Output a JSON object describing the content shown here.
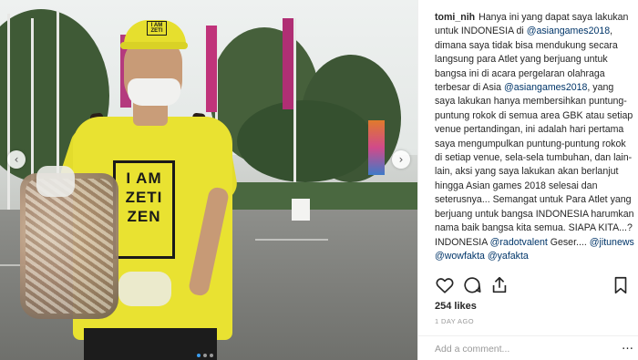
{
  "photo": {
    "cap_text": "I AM ZETI",
    "shirt_text": [
      "I AM",
      "ZETI",
      "ZEN"
    ],
    "nav_prev": "‹",
    "nav_next": "›"
  },
  "post": {
    "username": "tomi_nih",
    "caption_segments": [
      {
        "t": "Hanya ini yang dapat saya lakukan untuk INDONESIA di ",
        "m": false
      },
      {
        "t": "@asiangames2018",
        "m": true
      },
      {
        "t": ", dimana saya tidak bisa mendukung secara langsung para Atlet yang berjuang untuk bangsa ini di acara pergelaran olahraga terbesar di Asia ",
        "m": false
      },
      {
        "t": "@asiangames2018",
        "m": true
      },
      {
        "t": ", yang saya lakukan hanya membersihkan puntung-puntung rokok di semua area GBK atau setiap venue pertandingan, ini adalah hari pertama saya mengumpulkan puntung-puntung rokok di setiap venue, sela-sela tumbuhan, dan lain-lain, aksi yang saya lakukan akan berlanjut hingga Asian games 2018 selesai dan seterusnya... Semangat untuk Para Atlet yang berjuang untuk bangsa INDONESIA harumkan nama baik bangsa kita semua. SIAPA KITA...? INDONESIA ",
        "m": false
      },
      {
        "t": "@radotvalent",
        "m": true
      },
      {
        "t": " Geser.... ",
        "m": false
      },
      {
        "t": "@jitunews",
        "m": true
      },
      {
        "t": " ",
        "m": false
      },
      {
        "t": "@wowfakta",
        "m": true
      },
      {
        "t": " ",
        "m": false
      },
      {
        "t": "@yafakta",
        "m": true
      }
    ],
    "likes": "254 likes",
    "time": "1 DAY AGO",
    "comment_placeholder": "Add a comment...",
    "more": "…"
  },
  "icons": [
    "chevron-left-icon",
    "chevron-right-icon",
    "heart-icon",
    "comment-icon",
    "share-icon",
    "bookmark-icon",
    "more-icon"
  ],
  "colors": {
    "mention": "#003569",
    "text": "#262626",
    "muted": "#999999",
    "active_dot": "#3b9df0"
  }
}
